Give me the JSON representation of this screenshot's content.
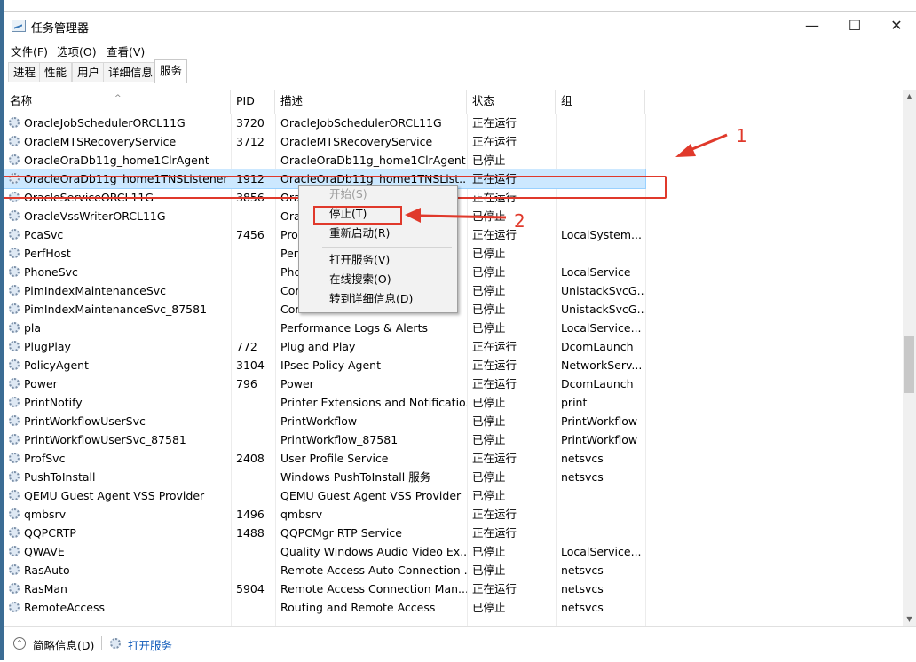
{
  "window": {
    "title": "任务管理器"
  },
  "titlebar_buttons": {
    "minimize": "—",
    "maximize": "☐",
    "close": "✕"
  },
  "menu": [
    "文件(F)",
    "选项(O)",
    "查看(V)"
  ],
  "tabs": [
    "进程",
    "性能",
    "用户",
    "详细信息",
    "服务"
  ],
  "active_tab": "服务",
  "columns": [
    "名称",
    "PID",
    "描述",
    "状态",
    "组"
  ],
  "rows": [
    {
      "name": "OracleJobSchedulerORCL11G",
      "pid": "3720",
      "desc": "OracleJobSchedulerORCL11G",
      "status": "正在运行",
      "group": ""
    },
    {
      "name": "OracleMTSRecoveryService",
      "pid": "3712",
      "desc": "OracleMTSRecoveryService",
      "status": "正在运行",
      "group": ""
    },
    {
      "name": "OracleOraDb11g_home1ClrAgent",
      "pid": "",
      "desc": "OracleOraDb11g_home1ClrAgent",
      "status": "已停止",
      "group": ""
    },
    {
      "name": "OracleOraDb11g_home1TNSListener",
      "pid": "1912",
      "desc": "OracleOraDb11g_home1TNSList...",
      "status": "正在运行",
      "group": ""
    },
    {
      "name": "OracleServiceORCL11G",
      "pid": "3856",
      "desc": "Ora",
      "status": "正在运行",
      "group": ""
    },
    {
      "name": "OracleVssWriterORCL11G",
      "pid": "",
      "desc": "Ora",
      "status": "已停止",
      "group": ""
    },
    {
      "name": "PcaSvc",
      "pid": "7456",
      "desc": "Pro",
      "status": "正在运行",
      "group": "LocalSystem..."
    },
    {
      "name": "PerfHost",
      "pid": "",
      "desc": "Per",
      "status": "已停止",
      "group": ""
    },
    {
      "name": "PhoneSvc",
      "pid": "",
      "desc": "Pho",
      "status": "已停止",
      "group": "LocalService"
    },
    {
      "name": "PimIndexMaintenanceSvc",
      "pid": "",
      "desc": "Cor",
      "status": "已停止",
      "group": "UnistackSvcG..."
    },
    {
      "name": "PimIndexMaintenanceSvc_87581",
      "pid": "",
      "desc": "Cor",
      "status": "已停止",
      "group": "UnistackSvcG..."
    },
    {
      "name": "pla",
      "pid": "",
      "desc": "Performance Logs & Alerts",
      "status": "已停止",
      "group": "LocalService..."
    },
    {
      "name": "PlugPlay",
      "pid": "772",
      "desc": "Plug and Play",
      "status": "正在运行",
      "group": "DcomLaunch"
    },
    {
      "name": "PolicyAgent",
      "pid": "3104",
      "desc": "IPsec Policy Agent",
      "status": "正在运行",
      "group": "NetworkServ..."
    },
    {
      "name": "Power",
      "pid": "796",
      "desc": "Power",
      "status": "正在运行",
      "group": "DcomLaunch"
    },
    {
      "name": "PrintNotify",
      "pid": "",
      "desc": "Printer Extensions and Notificatio...",
      "status": "已停止",
      "group": "print"
    },
    {
      "name": "PrintWorkflowUserSvc",
      "pid": "",
      "desc": "PrintWorkflow",
      "status": "已停止",
      "group": "PrintWorkflow"
    },
    {
      "name": "PrintWorkflowUserSvc_87581",
      "pid": "",
      "desc": "PrintWorkflow_87581",
      "status": "已停止",
      "group": "PrintWorkflow"
    },
    {
      "name": "ProfSvc",
      "pid": "2408",
      "desc": "User Profile Service",
      "status": "正在运行",
      "group": "netsvcs"
    },
    {
      "name": "PushToInstall",
      "pid": "",
      "desc": "Windows PushToInstall 服务",
      "status": "已停止",
      "group": "netsvcs"
    },
    {
      "name": "QEMU Guest Agent VSS Provider",
      "pid": "",
      "desc": "QEMU Guest Agent VSS Provider",
      "status": "已停止",
      "group": ""
    },
    {
      "name": "qmbsrv",
      "pid": "1496",
      "desc": "qmbsrv",
      "status": "正在运行",
      "group": ""
    },
    {
      "name": "QQPCRTP",
      "pid": "1488",
      "desc": "QQPCMgr RTP Service",
      "status": "正在运行",
      "group": ""
    },
    {
      "name": "QWAVE",
      "pid": "",
      "desc": "Quality Windows Audio Video Ex...",
      "status": "已停止",
      "group": "LocalService..."
    },
    {
      "name": "RasAuto",
      "pid": "",
      "desc": "Remote Access Auto Connection ...",
      "status": "已停止",
      "group": "netsvcs"
    },
    {
      "name": "RasMan",
      "pid": "5904",
      "desc": "Remote Access Connection Man...",
      "status": "正在运行",
      "group": "netsvcs"
    },
    {
      "name": "RemoteAccess",
      "pid": "",
      "desc": "Routing and Remote Access",
      "status": "已停止",
      "group": "netsvcs"
    }
  ],
  "selected_row": 3,
  "context_menu": {
    "start": "开始(S)",
    "stop": "停止(T)",
    "restart": "重新启动(R)",
    "open_services": "打开服务(V)",
    "search_online": "在线搜索(O)",
    "go_to_details": "转到详细信息(D)"
  },
  "annotations": {
    "one": "1",
    "two": "2"
  },
  "annotation_color": "#e0392b",
  "status_bar": {
    "fewer_details": "简略信息(D)",
    "open_services": "打开服务"
  }
}
